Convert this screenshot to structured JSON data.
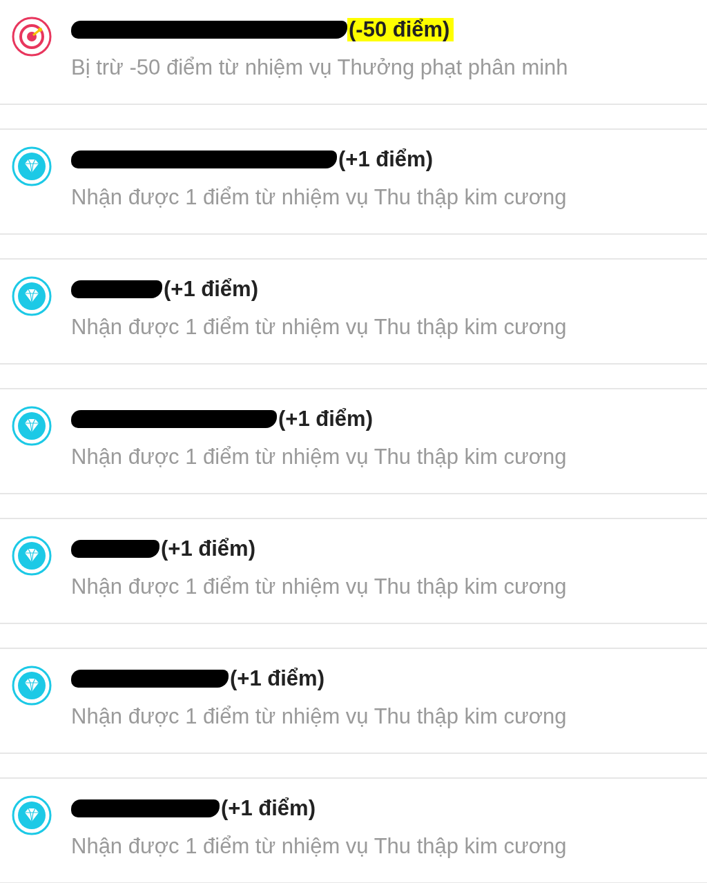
{
  "activity_items": [
    {
      "kind": "penalty",
      "points": "(-50 điểm)",
      "highlighted": true,
      "description": "Bị trừ -50 điểm từ nhiệm vụ Thưởng phạt phân minh"
    },
    {
      "kind": "reward",
      "points": "(+1 điểm)",
      "highlighted": false,
      "description": "Nhận được 1 điểm từ nhiệm vụ Thu thập kim cương"
    },
    {
      "kind": "reward",
      "points": "(+1 điểm)",
      "highlighted": false,
      "description": "Nhận được 1 điểm từ nhiệm vụ Thu thập kim cương"
    },
    {
      "kind": "reward",
      "points": "(+1 điểm)",
      "highlighted": false,
      "description": "Nhận được 1 điểm từ nhiệm vụ Thu thập kim cương"
    },
    {
      "kind": "reward",
      "points": "(+1 điểm)",
      "highlighted": false,
      "description": "Nhận được 1 điểm từ nhiệm vụ Thu thập kim cương"
    },
    {
      "kind": "reward",
      "points": "(+1 điểm)",
      "highlighted": false,
      "description": "Nhận được 1 điểm từ nhiệm vụ Thu thập kim cương"
    },
    {
      "kind": "reward",
      "points": "(+1 điểm)",
      "highlighted": false,
      "description": "Nhận được 1 điểm từ nhiệm vụ Thu thập kim cương"
    }
  ]
}
